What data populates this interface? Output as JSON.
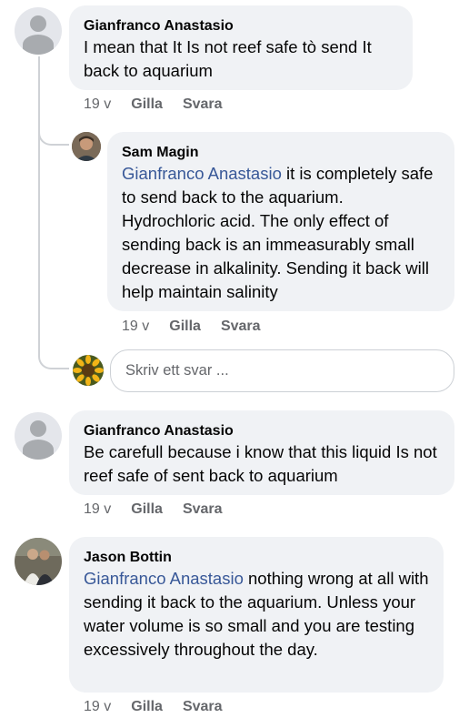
{
  "comments": [
    {
      "author": "Gianfranco Anastasio",
      "text": "I mean that It Is not reef safe tò send It back to aquarium",
      "time": "19 v",
      "like": "Gilla",
      "reply": "Svara"
    },
    {
      "author": "Sam Magin",
      "mention": "Gianfranco Anastasio",
      "text": " it is completely safe to send back to the aquarium. Hydrochloric acid. The only effect of sending back is an immeasurably small decrease in alkalinity. Sending it back will help maintain salinity",
      "time": "19 v",
      "like": "Gilla",
      "reply": "Svara"
    },
    {
      "author": "Gianfranco Anastasio",
      "text": "Be carefull because i know that this liquid Is not reef safe of sent back to aquarium",
      "time": "19 v",
      "like": "Gilla",
      "reply": "Svara"
    },
    {
      "author": "Jason Bottin",
      "mention": "Gianfranco Anastasio",
      "text": " nothing wrong at all with sending it back to the aquarium. Unless your water volume is so small and you are testing excessively throughout the day.",
      "time": "19 v",
      "like": "Gilla",
      "reply": "Svara"
    }
  ],
  "reply_box": {
    "placeholder": "Skriv ett svar ..."
  },
  "colors": {
    "bubble": "#f0f2f5",
    "mention": "#385898",
    "meta": "#65676b"
  }
}
